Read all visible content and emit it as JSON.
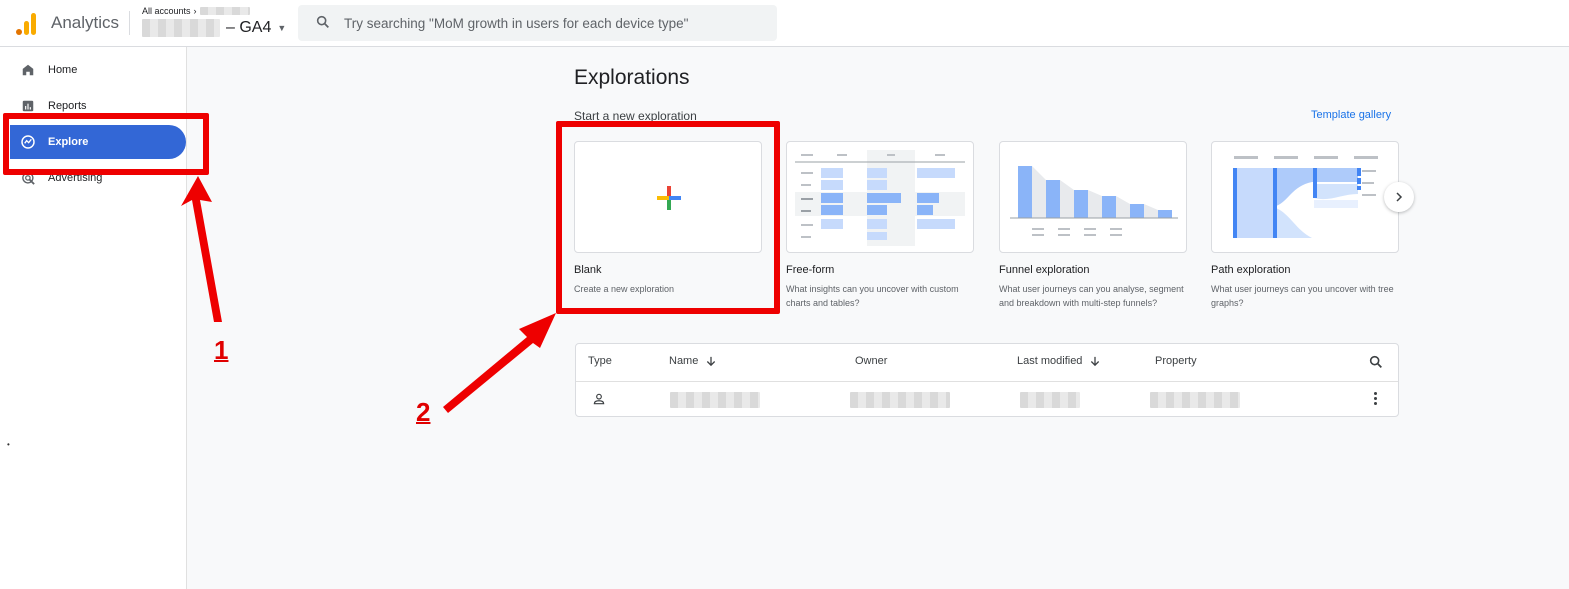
{
  "app": {
    "name": "Analytics",
    "breadcrumb": "All accounts",
    "property_suffix": "– GA4",
    "search_placeholder": "Try searching \"MoM growth in users for each device type\""
  },
  "sidebar": {
    "items": [
      {
        "label": "Home",
        "icon": "home-icon"
      },
      {
        "label": "Reports",
        "icon": "reports-icon"
      },
      {
        "label": "Explore",
        "icon": "explore-icon",
        "active": true
      },
      {
        "label": "Advertising",
        "icon": "advertising-icon"
      }
    ]
  },
  "main": {
    "title": "Explorations",
    "section_label": "Start a new exploration",
    "template_link": "Template gallery",
    "cards": [
      {
        "title": "Blank",
        "desc": "Create a new exploration"
      },
      {
        "title": "Free-form",
        "desc": "What insights can you uncover with custom charts and tables?"
      },
      {
        "title": "Funnel exploration",
        "desc": "What user journeys can you analyse, segment and breakdown with multi-step funnels?"
      },
      {
        "title": "Path exploration",
        "desc": "What user journeys can you uncover with tree graphs?"
      }
    ]
  },
  "table": {
    "columns": [
      "Type",
      "Name",
      "Owner",
      "Last modified",
      "Property"
    ]
  },
  "annotations": {
    "step1": "1",
    "step2": "2"
  },
  "colors": {
    "accent": "#3367d6",
    "link": "#1a73e8",
    "annotation": "#ee0000"
  }
}
